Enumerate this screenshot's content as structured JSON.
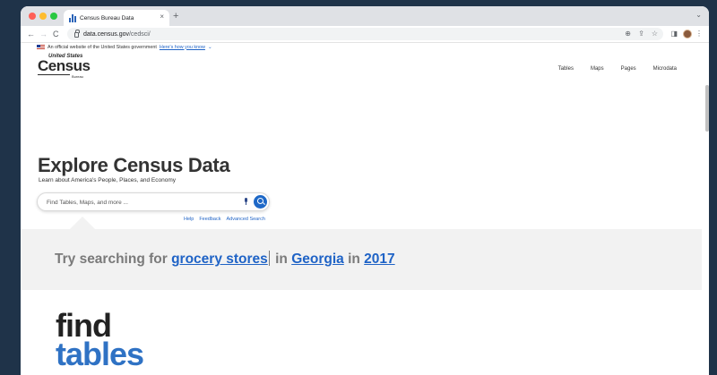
{
  "browser": {
    "tab_title": "Census Bureau Data",
    "tab_close": "×",
    "new_tab": "+",
    "url_host": "data.census.gov",
    "url_path": "/cedsci/",
    "back": "←",
    "forward": "→",
    "reload": "C"
  },
  "gov_banner": {
    "text": "An official website of the United States government",
    "link": "Here's how you know",
    "chevron": "⌄"
  },
  "logo": {
    "top": "United States",
    "main": "Census",
    "sub": "Bureau"
  },
  "nav": {
    "items": [
      "Tables",
      "Maps",
      "Pages",
      "Microdata"
    ]
  },
  "hero": {
    "title": "Explore Census Data",
    "subtitle": "Learn about America's People, Places, and Economy",
    "search_placeholder": "Find Tables, Maps, and more ...",
    "links": [
      "Help",
      "Feedback",
      "Advanced Search"
    ]
  },
  "try_search": {
    "prefix": "Try searching for",
    "topic": "grocery stores",
    "in1": "in",
    "place": "Georgia",
    "in2": "in",
    "year": "2017"
  },
  "find_section": {
    "line1": "find",
    "line2": "tables"
  },
  "colors": {
    "accent": "#1e68c7",
    "background": "#1f3349"
  }
}
